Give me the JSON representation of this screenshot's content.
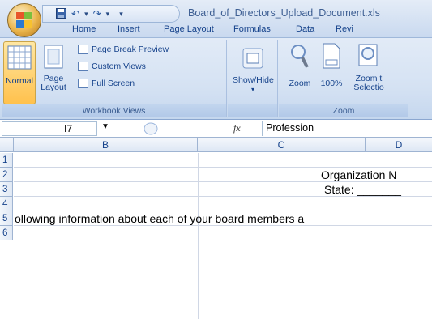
{
  "window": {
    "title": "Board_of_Directors_Upload_Document.xls"
  },
  "office_button": {
    "icon": "office-logo-icon"
  },
  "quick_access": {
    "icons": [
      "save-icon",
      "undo-icon",
      "redo-icon",
      "customize-qat-icon"
    ],
    "undo_arrow": "▾",
    "redo_arrow": "▾",
    "customize": "▾"
  },
  "tabs": [
    "Home",
    "Insert",
    "Page Layout",
    "Formulas",
    "Data",
    "Revi"
  ],
  "ribbon": {
    "workbook_views": {
      "label": "Workbook Views",
      "normal": "Normal",
      "page_layout_1": "Page",
      "page_layout_2": "Layout",
      "page_break_preview": "Page Break Preview",
      "custom_views": "Custom Views",
      "full_screen": "Full Screen"
    },
    "show_hide": {
      "label": "Show/Hide",
      "arrow": "▾"
    },
    "zoom": {
      "label": "Zoom",
      "zoom": "Zoom",
      "hundred": "100%",
      "zoom_to_1": "Zoom t",
      "zoom_to_2": "Selectio"
    }
  },
  "formula_bar": {
    "name_box": "I7",
    "fx": "fx",
    "content": "Profession"
  },
  "columns": [
    "B",
    "C",
    "D"
  ],
  "rows": [
    "1",
    "2",
    "3",
    "4",
    "5",
    "6"
  ],
  "cells": {
    "c2": "Organization N",
    "c3": "State: _______",
    "b5": "ollowing information about each of your board members a"
  },
  "colors": {
    "accent": "#ffc14d",
    "ribbon": "#d5e2f3",
    "header_text": "#15428b"
  }
}
